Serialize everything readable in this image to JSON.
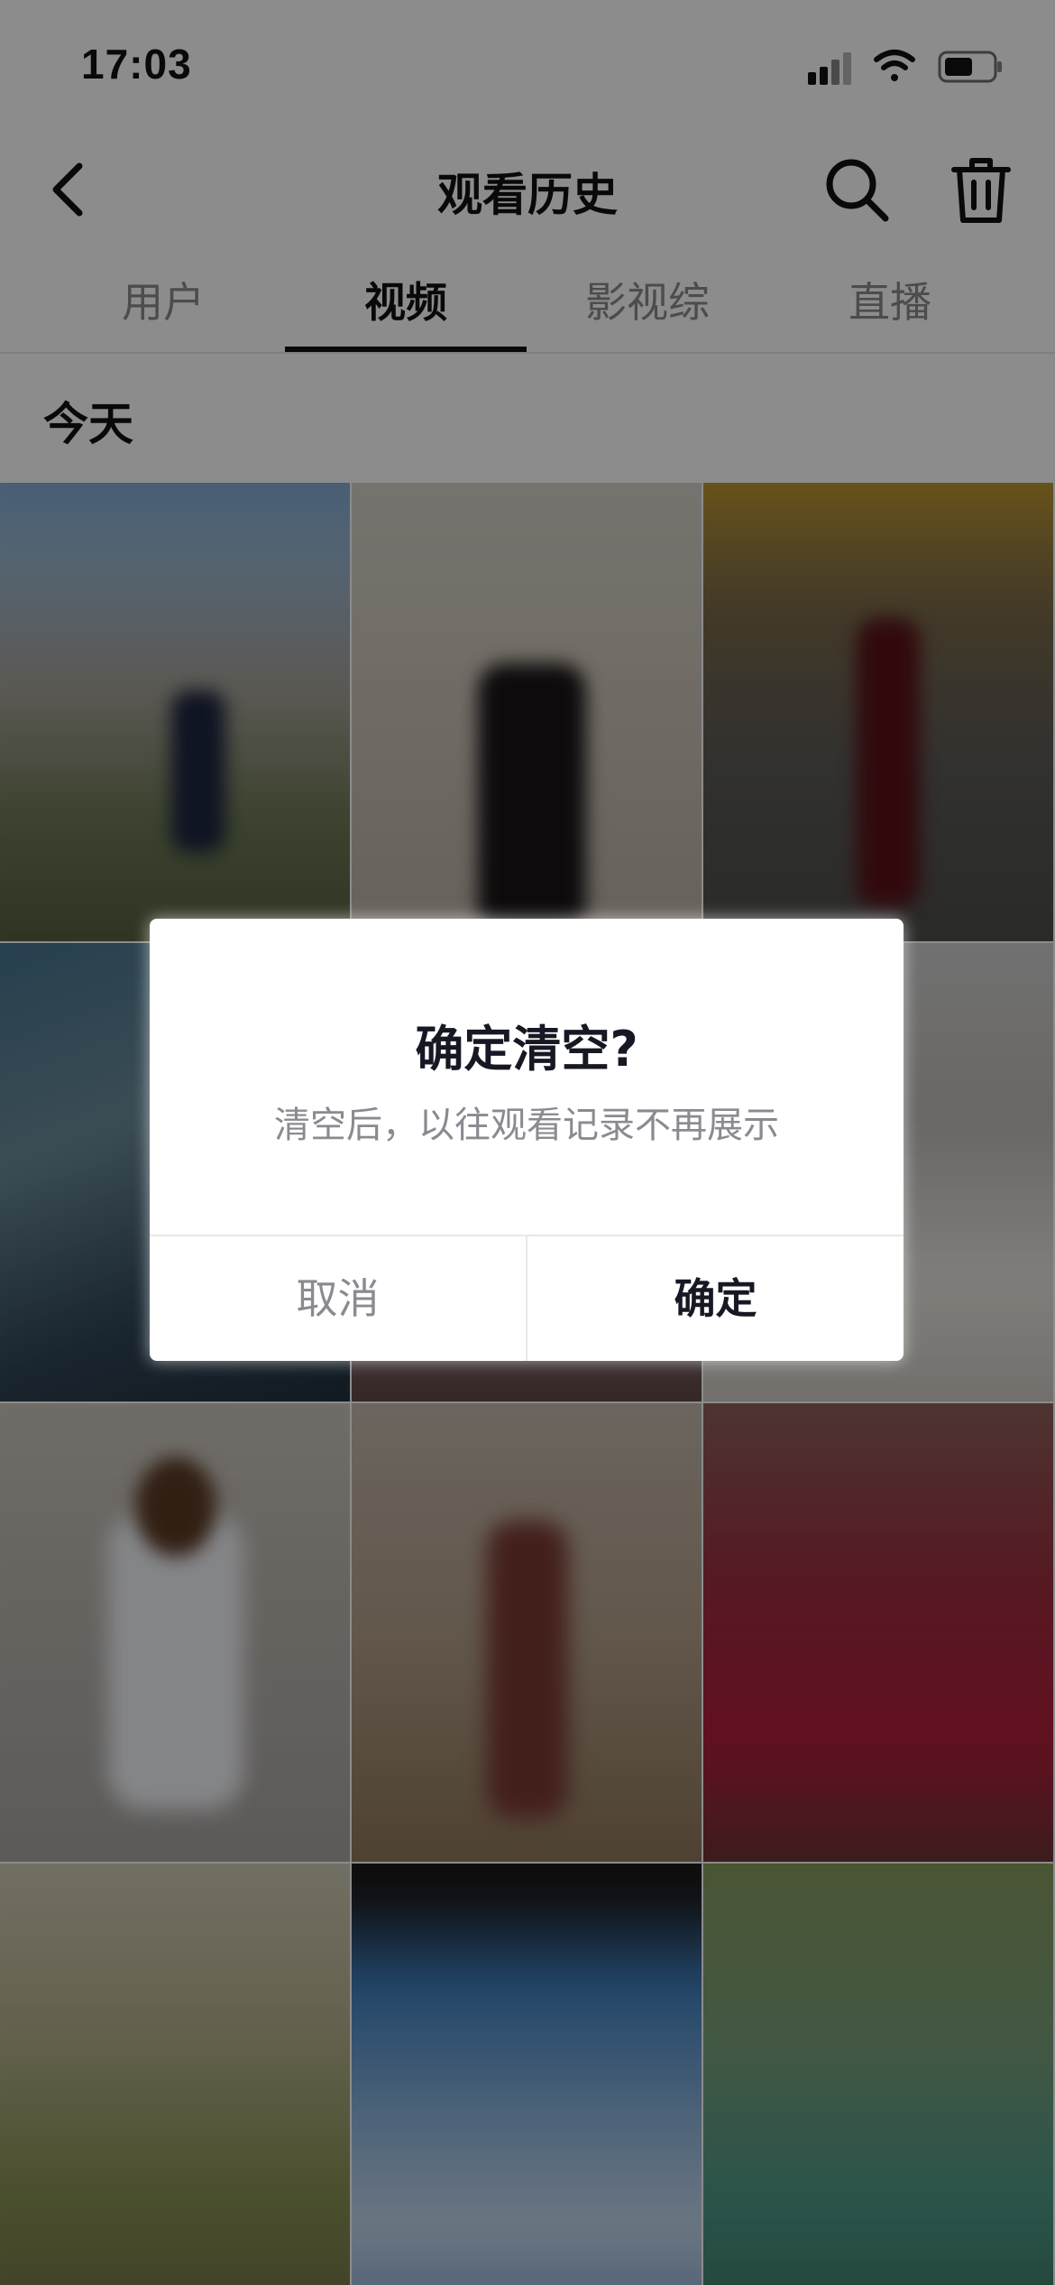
{
  "status_bar": {
    "time": "17:03"
  },
  "nav": {
    "title": "观看历史",
    "back_icon": "chevron-left-icon",
    "search_icon": "search-icon",
    "trash_icon": "trash-icon"
  },
  "tabs": [
    {
      "label": "用户",
      "active": false
    },
    {
      "label": "视频",
      "active": true
    },
    {
      "label": "影视综",
      "active": false
    },
    {
      "label": "直播",
      "active": false
    }
  ],
  "section": {
    "today": "今天"
  },
  "dialog": {
    "title": "确定清空?",
    "message": "清空后，以往观看记录不再展示",
    "cancel_label": "取消",
    "confirm_label": "确定"
  }
}
